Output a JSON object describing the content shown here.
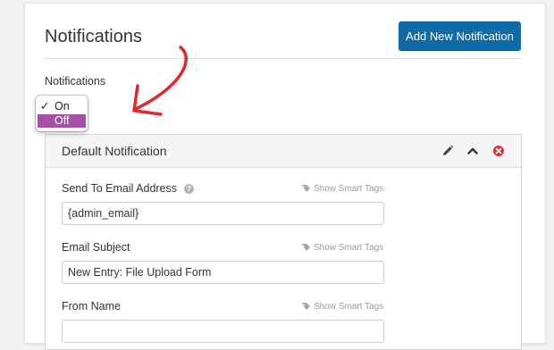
{
  "header": {
    "title": "Notifications",
    "add_button_label": "Add New Notification"
  },
  "notifications_toggle": {
    "label": "Notifications",
    "options": [
      {
        "label": "On",
        "checked": true
      },
      {
        "label": "Off",
        "highlighted": true
      }
    ],
    "highlight_color": "#a64fa8"
  },
  "notification": {
    "title": "Default Notification",
    "icons": [
      "pencil-icon",
      "chevron-up-icon",
      "close-circle-icon"
    ],
    "fields": [
      {
        "label": "Send To Email Address",
        "value": "{admin_email}",
        "smart_tags": "Show Smart Tags",
        "help": "?"
      },
      {
        "label": "Email Subject",
        "value": "New Entry: File Upload Form",
        "smart_tags": "Show Smart Tags"
      },
      {
        "label": "From Name",
        "value": "",
        "smart_tags": "Show Smart Tags"
      }
    ]
  },
  "colors": {
    "primary_button": "#0e6ba6",
    "annotation_arrow": "#e3272f",
    "close_icon": "#d63638"
  }
}
